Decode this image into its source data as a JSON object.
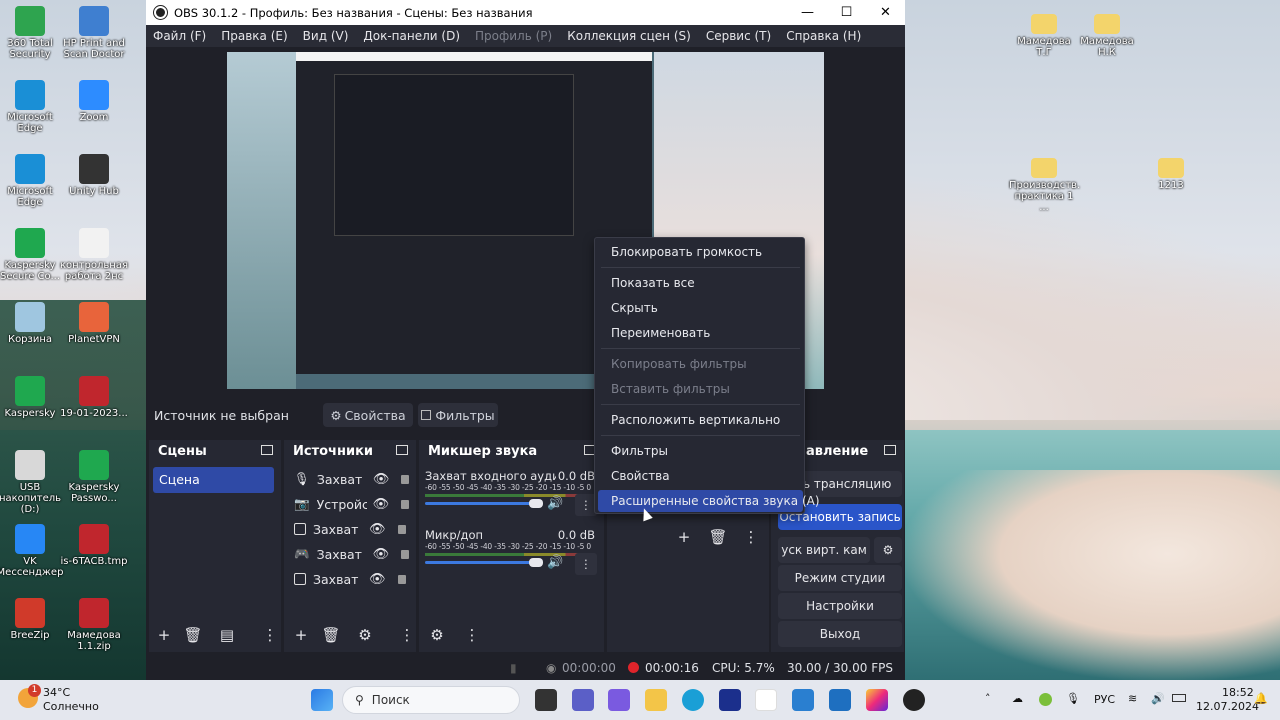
{
  "desktop": {
    "left_icons": [
      {
        "label": "360 Total Security",
        "color": "#2ea44f"
      },
      {
        "label": "HP Print and Scan Doctor",
        "color": "#3f7fd0"
      },
      {
        "label": "Microsoft Edge",
        "color": "#1a8fd6"
      },
      {
        "label": "Zoom",
        "color": "#2d8cff"
      },
      {
        "label": "Microsoft Edge",
        "color": "#1a8fd6"
      },
      {
        "label": "Unity Hub",
        "color": "#333333"
      },
      {
        "label": "Kaspersky Secure Co...",
        "color": "#1fa84f"
      },
      {
        "label": "контрольная работа 2нс",
        "color": "#f2f2f2"
      },
      {
        "label": "Корзина",
        "color": "#9fc6e0"
      },
      {
        "label": "PlanetVPN",
        "color": "#e8643b"
      },
      {
        "label": "Kaspersky",
        "color": "#1fa84f"
      },
      {
        "label": "19-01-2023...",
        "color": "#c0262d"
      },
      {
        "label": "USB накопитель (D:)",
        "color": "#d8d8d8"
      },
      {
        "label": "Kaspersky Passwo...",
        "color": "#1fa84f"
      },
      {
        "label": "VK Мессенджер",
        "color": "#2787f5"
      },
      {
        "label": "is-6TACB.tmp",
        "color": "#c0262d"
      },
      {
        "label": "BreeZip",
        "color": "#d03a2a"
      },
      {
        "label": "Мамедова 1.1.zip",
        "color": "#c0262d"
      }
    ],
    "right_icons": [
      {
        "label": "Мамедова Т.Г"
      },
      {
        "label": "Мамедова Н.К"
      },
      {
        "label": "Производств. практика 1 ..."
      },
      {
        "label": "1213"
      }
    ]
  },
  "window": {
    "title": "OBS 30.1.2 - Профиль: Без названия - Сцены: Без названия",
    "min": "—",
    "max": "☐",
    "close": "✕"
  },
  "menu": [
    {
      "label": "Файл (F)",
      "disabled": false
    },
    {
      "label": "Правка (E)",
      "disabled": false
    },
    {
      "label": "Вид (V)",
      "disabled": false
    },
    {
      "label": "Док-панели (D)",
      "disabled": false
    },
    {
      "label": "Профиль (P)",
      "disabled": true
    },
    {
      "label": "Коллекция сцен (S)",
      "disabled": false
    },
    {
      "label": "Сервис (T)",
      "disabled": false
    },
    {
      "label": "Справка (H)",
      "disabled": false
    }
  ],
  "source_bar": {
    "no_source": "Источник не выбран",
    "properties": "Свойства",
    "filters": "Фильтры"
  },
  "scenes": {
    "title": "Сцены",
    "items": [
      "Сцена"
    ]
  },
  "sources": {
    "title": "Источники",
    "items": [
      "Захват вх",
      "Устройст",
      "Захват ок",
      "Захват иг",
      "Захват эк"
    ]
  },
  "mixer": {
    "title": "Микшер звука",
    "channels": [
      {
        "name": "Захват входного аудиопотока",
        "db": "0.0 dB",
        "scale": "-60 -55 -50 -45 -40 -35 -30 -25 -20 -15 -10 -5 0"
      },
      {
        "name": "Микр/доп",
        "db": "0.0 dB",
        "scale": "-60 -55 -50 -45 -40 -35 -30 -25 -20 -15 -10 -5 0"
      }
    ]
  },
  "controls": {
    "title": "Управление",
    "title_visible": "авление",
    "start_stream": "ать трансляцию",
    "stop_record": "Остановить запись",
    "virtual_cam": "уск вирт. кам",
    "studio_mode": "Режим студии",
    "settings": "Настройки",
    "exit": "Выход"
  },
  "context_menu": [
    {
      "label": "Блокировать громкость",
      "disabled": false
    },
    {
      "label": "Показать все",
      "disabled": false
    },
    {
      "label": "Скрыть",
      "disabled": false
    },
    {
      "label": "Переименовать",
      "disabled": false
    },
    {
      "label": "Копировать фильтры",
      "disabled": true
    },
    {
      "label": "Вставить фильтры",
      "disabled": true
    },
    {
      "label": "Расположить вертикально",
      "disabled": false
    },
    {
      "label": "Фильтры",
      "disabled": false
    },
    {
      "label": "Свойства",
      "disabled": false
    },
    {
      "label": "Расширенные свойства звука (A)",
      "disabled": false,
      "highlighted": true
    }
  ],
  "status": {
    "stream_time": "00:00:00",
    "record_time": "00:00:16",
    "cpu": "CPU: 5.7%",
    "fps": "30.00 / 30.00 FPS"
  },
  "taskbar": {
    "weather_temp": "34°C",
    "weather_desc": "Солнечно",
    "weather_badge": "1",
    "search_placeholder": "Поиск",
    "lang": "РУС",
    "time": "18:52",
    "date": "12.07.2024"
  },
  "colors": {
    "accent": "#2f4aa6",
    "record_red": "#e0242b",
    "stop_record_bg": "#2a55c9"
  }
}
